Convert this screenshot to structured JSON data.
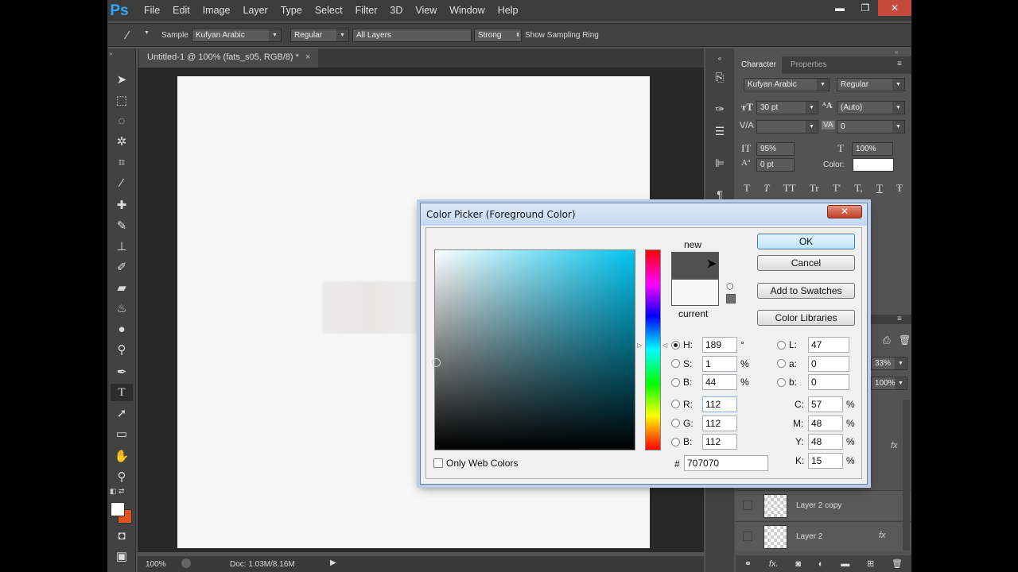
{
  "app": {
    "logo": "Ps",
    "menu": [
      "File",
      "Edit",
      "Image",
      "Layer",
      "Type",
      "Select",
      "Filter",
      "3D",
      "View",
      "Window",
      "Help"
    ],
    "window_controls": {
      "minimize": "▬",
      "restore": "❐",
      "close": "✕"
    }
  },
  "options_bar": {
    "sample_label": "Sample",
    "font_value": "Kufyan Arabic",
    "style_value": "Regular",
    "layers_value": "All Layers",
    "strength_value": "Strong",
    "show_ring_label": "Show Sampling Ring"
  },
  "document": {
    "tab_title": "Untitled-1 @ 100% (fats_s05, RGB/8) *",
    "tab_close": "×"
  },
  "status_bar": {
    "zoom": "100%",
    "doc_info": "Doc: 1.03M/8.16M"
  },
  "character_panel": {
    "tabs": [
      "Character",
      "Properties"
    ],
    "font_family": "Kufyan Arabic",
    "font_style": "Regular",
    "size": "30 pt",
    "leading": "(Auto)",
    "kerning": "",
    "tracking": "0",
    "vertical_scale": "95%",
    "horizontal_scale": "100%",
    "baseline_shift": "0 pt",
    "color_label": "Color:",
    "color_swatch": "#ffffff",
    "type_styles": [
      "T",
      "T",
      "TT",
      "Tr",
      "T'",
      "T,",
      "T",
      "Ŧ"
    ]
  },
  "layers_panel": {
    "opacity_partial": "33%",
    "fill_partial": "100%",
    "layers": [
      {
        "name": "Layer 2 copy",
        "fx": false
      },
      {
        "name": "Layer 2",
        "fx": true
      }
    ],
    "fx_label": "fx"
  },
  "color_picker": {
    "title": "Color Picker (Foreground Color)",
    "new_label": "new",
    "current_label": "current",
    "new_color": "#505050",
    "current_color": "#f7f7f8",
    "buttons": {
      "ok": "OK",
      "cancel": "Cancel",
      "add_swatches": "Add to Swatches",
      "color_libraries": "Color Libraries"
    },
    "hsb": {
      "h_label": "H:",
      "h_value": "189",
      "h_unit": "°",
      "s_label": "S:",
      "s_value": "1",
      "s_unit": "%",
      "b_label": "B:",
      "b_value": "44",
      "b_unit": "%"
    },
    "rgb": {
      "r_label": "R:",
      "r_value": "112",
      "g_label": "G:",
      "g_value": "112",
      "b_label": "B:",
      "b_value": "112"
    },
    "lab": {
      "l_label": "L:",
      "l_value": "47",
      "a_label": "a:",
      "a_value": "0",
      "b_label": "b:",
      "b_value": "0"
    },
    "cmyk": {
      "c_label": "C:",
      "c_value": "57",
      "m_label": "M:",
      "m_value": "48",
      "y_label": "Y:",
      "y_value": "48",
      "k_label": "K:",
      "k_value": "15",
      "unit": "%"
    },
    "hex_label": "#",
    "hex_value": "707070",
    "web_only_label": "Only Web Colors",
    "field_hue": "#00c4ef"
  }
}
